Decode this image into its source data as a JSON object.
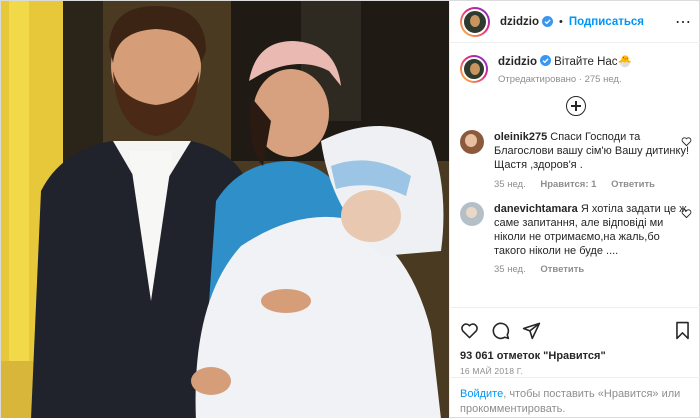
{
  "header": {
    "username": "dzidzio",
    "follow_label": "Подписаться",
    "dot": "•",
    "more": "⋯"
  },
  "caption": {
    "username": "dzidzio",
    "text": " Вітайте Нас🐣",
    "meta": "Отредактировано · 275 нед."
  },
  "comments": [
    {
      "username": "oleinik275",
      "text": " Спаси Господи та Благослови вашу сім'ю Вашу дитинку! Щастя ,здоров'я .",
      "age": "35 нед.",
      "likes": "Нравится: 1",
      "reply": "Ответить"
    },
    {
      "username": "danevichtamara",
      "text": " Я хотіла задати це ж саме запитання, але відповіді ми ніколи не отримаємо,на жаль,бо такого ніколи не буде ....",
      "age": "35 нед.",
      "reply": "Ответить"
    }
  ],
  "post": {
    "likes": "93 061 отметок \"Нравится\"",
    "date": "16 МАЙ 2018 Г."
  },
  "login": {
    "link": "Войдите",
    "rest": ", чтобы поставить «Нравится» или прокомментировать."
  },
  "icons": [
    "verified-icon",
    "more-icon",
    "add-comment-icon",
    "heart-icon",
    "comment-icon",
    "share-icon",
    "bookmark-icon"
  ],
  "colors": {
    "link": "#0095f6",
    "muted": "#8e8e8e",
    "text": "#262626"
  }
}
